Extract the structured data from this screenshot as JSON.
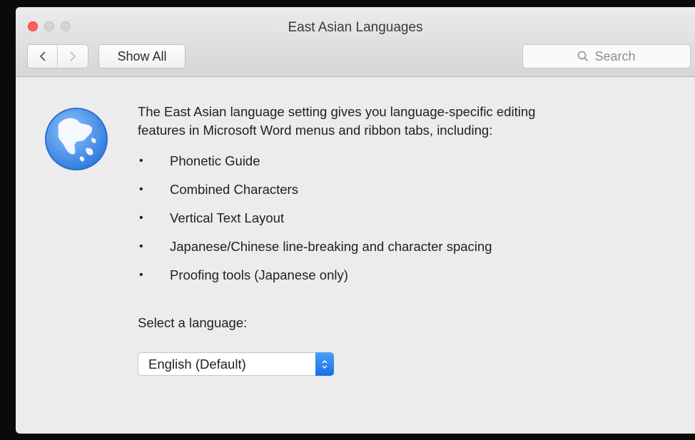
{
  "window": {
    "title": "East Asian Languages"
  },
  "toolbar": {
    "back_icon": "chevron-left-icon",
    "forward_icon": "chevron-right-icon",
    "show_all_label": "Show All",
    "search_placeholder": "Search",
    "search_icon": "search-icon"
  },
  "content": {
    "icon": "globe-icon",
    "intro_line1": "The East Asian language setting gives you language-specific editing",
    "intro_line2": "features in Microsoft Word menus and ribbon tabs, including:",
    "features": [
      "Phonetic Guide",
      "Combined Characters",
      "Vertical Text Layout",
      "Japanese/Chinese line-breaking and character spacing",
      "Proofing tools (Japanese only)"
    ],
    "select_label": "Select a language:",
    "select_value": "English (Default)"
  },
  "colors": {
    "close_button": "#fc5f57",
    "select_accent": "#1a6fe5",
    "globe_blue": "#3d8ae6"
  }
}
